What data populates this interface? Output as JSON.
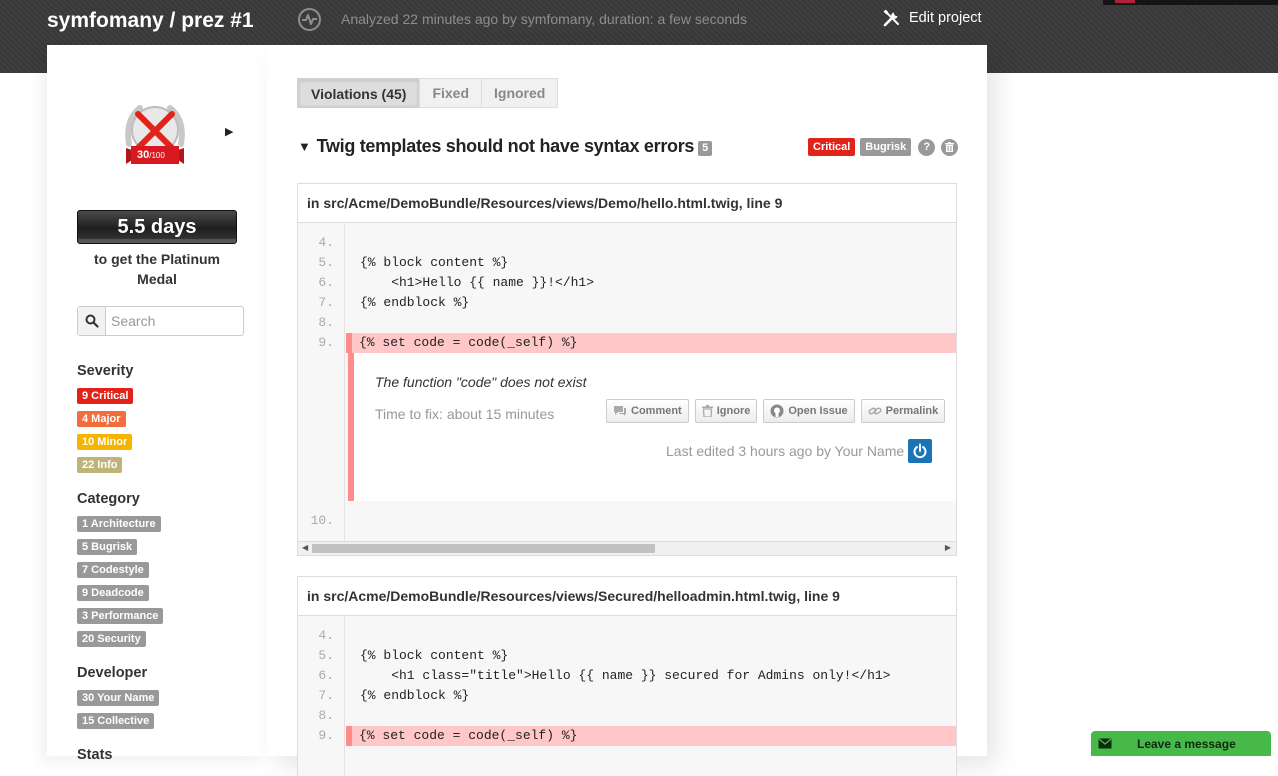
{
  "header": {
    "project_title": "symfomany / prez #1",
    "analyzed": "Analyzed 22 minutes ago by symfomany, duration: a few seconds",
    "edit_project": "Edit project"
  },
  "sidebar": {
    "medal": {
      "score": "30",
      "out_of": "/100"
    },
    "days": "5.5 days",
    "days_caption": "to get the Platinum Medal",
    "search_placeholder": "Search",
    "severity": {
      "heading": "Severity",
      "items": [
        {
          "label": "9 Critical",
          "color": "#e2231a"
        },
        {
          "label": "4 Major",
          "color": "#f26c3c"
        },
        {
          "label": "10 Minor",
          "color": "#f5b400"
        },
        {
          "label": "22 Info",
          "color": "#bfb477"
        }
      ]
    },
    "category": {
      "heading": "Category",
      "items": [
        "1 Architecture",
        "5 Bugrisk",
        "7 Codestyle",
        "9 Deadcode",
        "3 Performance",
        "20 Security"
      ]
    },
    "developer": {
      "heading": "Developer",
      "items": [
        "30 Your Name",
        "15 Collective"
      ]
    },
    "stats_heading": "Stats"
  },
  "main": {
    "tabs": [
      {
        "label": "Violations (45)",
        "active": true
      },
      {
        "label": "Fixed",
        "active": false
      },
      {
        "label": "Ignored",
        "active": false
      }
    ],
    "rule": {
      "title": "Twig templates should not have syntax errors",
      "count": "5",
      "tags": [
        {
          "label": "Critical",
          "color": "#e2231a"
        },
        {
          "label": "Bugrisk",
          "color": "#999999"
        }
      ]
    },
    "violations": [
      {
        "file": "in src/Acme/DemoBundle/Resources/views/Demo/hello.html.twig, line 9",
        "lines_before": [
          {
            "n": "4.",
            "code": ""
          },
          {
            "n": "5.",
            "code": "{% block content %}"
          },
          {
            "n": "6.",
            "code": "    <h1>Hello {{ name }}!</h1>"
          },
          {
            "n": "7.",
            "code": "{% endblock %}"
          },
          {
            "n": "8.",
            "code": ""
          }
        ],
        "highlight": {
          "n": "9.",
          "code": "{% set code = code(_self) %}"
        },
        "message": "The function \"code\" does not exist",
        "time_to_fix": "Time to fix: about 15 minutes",
        "actions": [
          "Comment",
          "Ignore",
          "Open Issue",
          "Permalink"
        ],
        "last_edited": "Last edited 3 hours ago by Your Name",
        "line_after": {
          "n": "10.",
          "code": ""
        }
      },
      {
        "file": "in src/Acme/DemoBundle/Resources/views/Secured/helloadmin.html.twig, line 9",
        "lines_before": [
          {
            "n": "4.",
            "code": ""
          },
          {
            "n": "5.",
            "code": "{% block content %}"
          },
          {
            "n": "6.",
            "code": "    <h1 class=\"title\">Hello {{ name }} secured for Admins only!</h1>"
          },
          {
            "n": "7.",
            "code": "{% endblock %}"
          },
          {
            "n": "8.",
            "code": ""
          }
        ],
        "highlight": {
          "n": "9.",
          "code": "{% set code = code(_self) %}"
        }
      }
    ]
  },
  "chat": {
    "label": "Leave a message"
  }
}
